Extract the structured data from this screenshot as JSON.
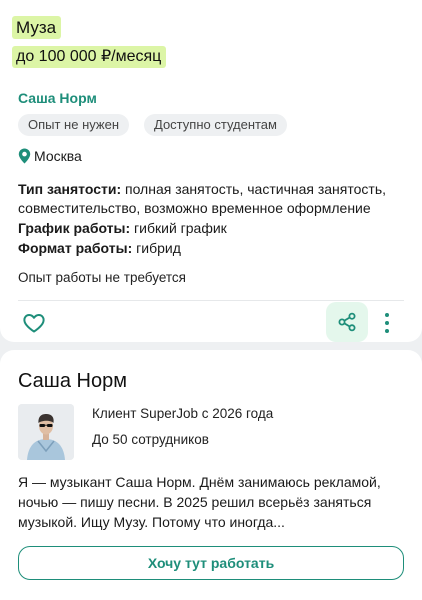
{
  "vacancy": {
    "title": "Муза",
    "salary": "до 100 000 ₽/месяц",
    "company": "Саша Норм",
    "tags": [
      "Опыт не нужен",
      "Доступно студентам"
    ],
    "location": "Москва",
    "details": [
      {
        "label": "Тип занятости:",
        "value": " полная занятость, частичная занятость, совместительство, возможно временное оформление"
      },
      {
        "label": "График работы:",
        "value": " гибкий график"
      },
      {
        "label": "Формат работы:",
        "value": " гибрид"
      }
    ],
    "experience": "Опыт работы не требуется",
    "accent_color": "#1e8e7a",
    "highlight_color": "#dcf5a6"
  },
  "actions": {
    "favorite_icon": "heart-icon",
    "share_icon": "share-icon",
    "more_icon": "more-vertical-icon"
  },
  "employer": {
    "name": "Саша Норм",
    "client_since": "Клиент SuperJob с 2026 года",
    "staff_size": "До 50 сотрудников",
    "about": "Я — музыкант Саша Норм. Днём занимаюсь рекламой, ночью — пишу песни. В 2025 решил всерьёз заняться музыкой. Ищу Музу. Потому что иногда...",
    "apply_label": "Хочу тут работать"
  }
}
